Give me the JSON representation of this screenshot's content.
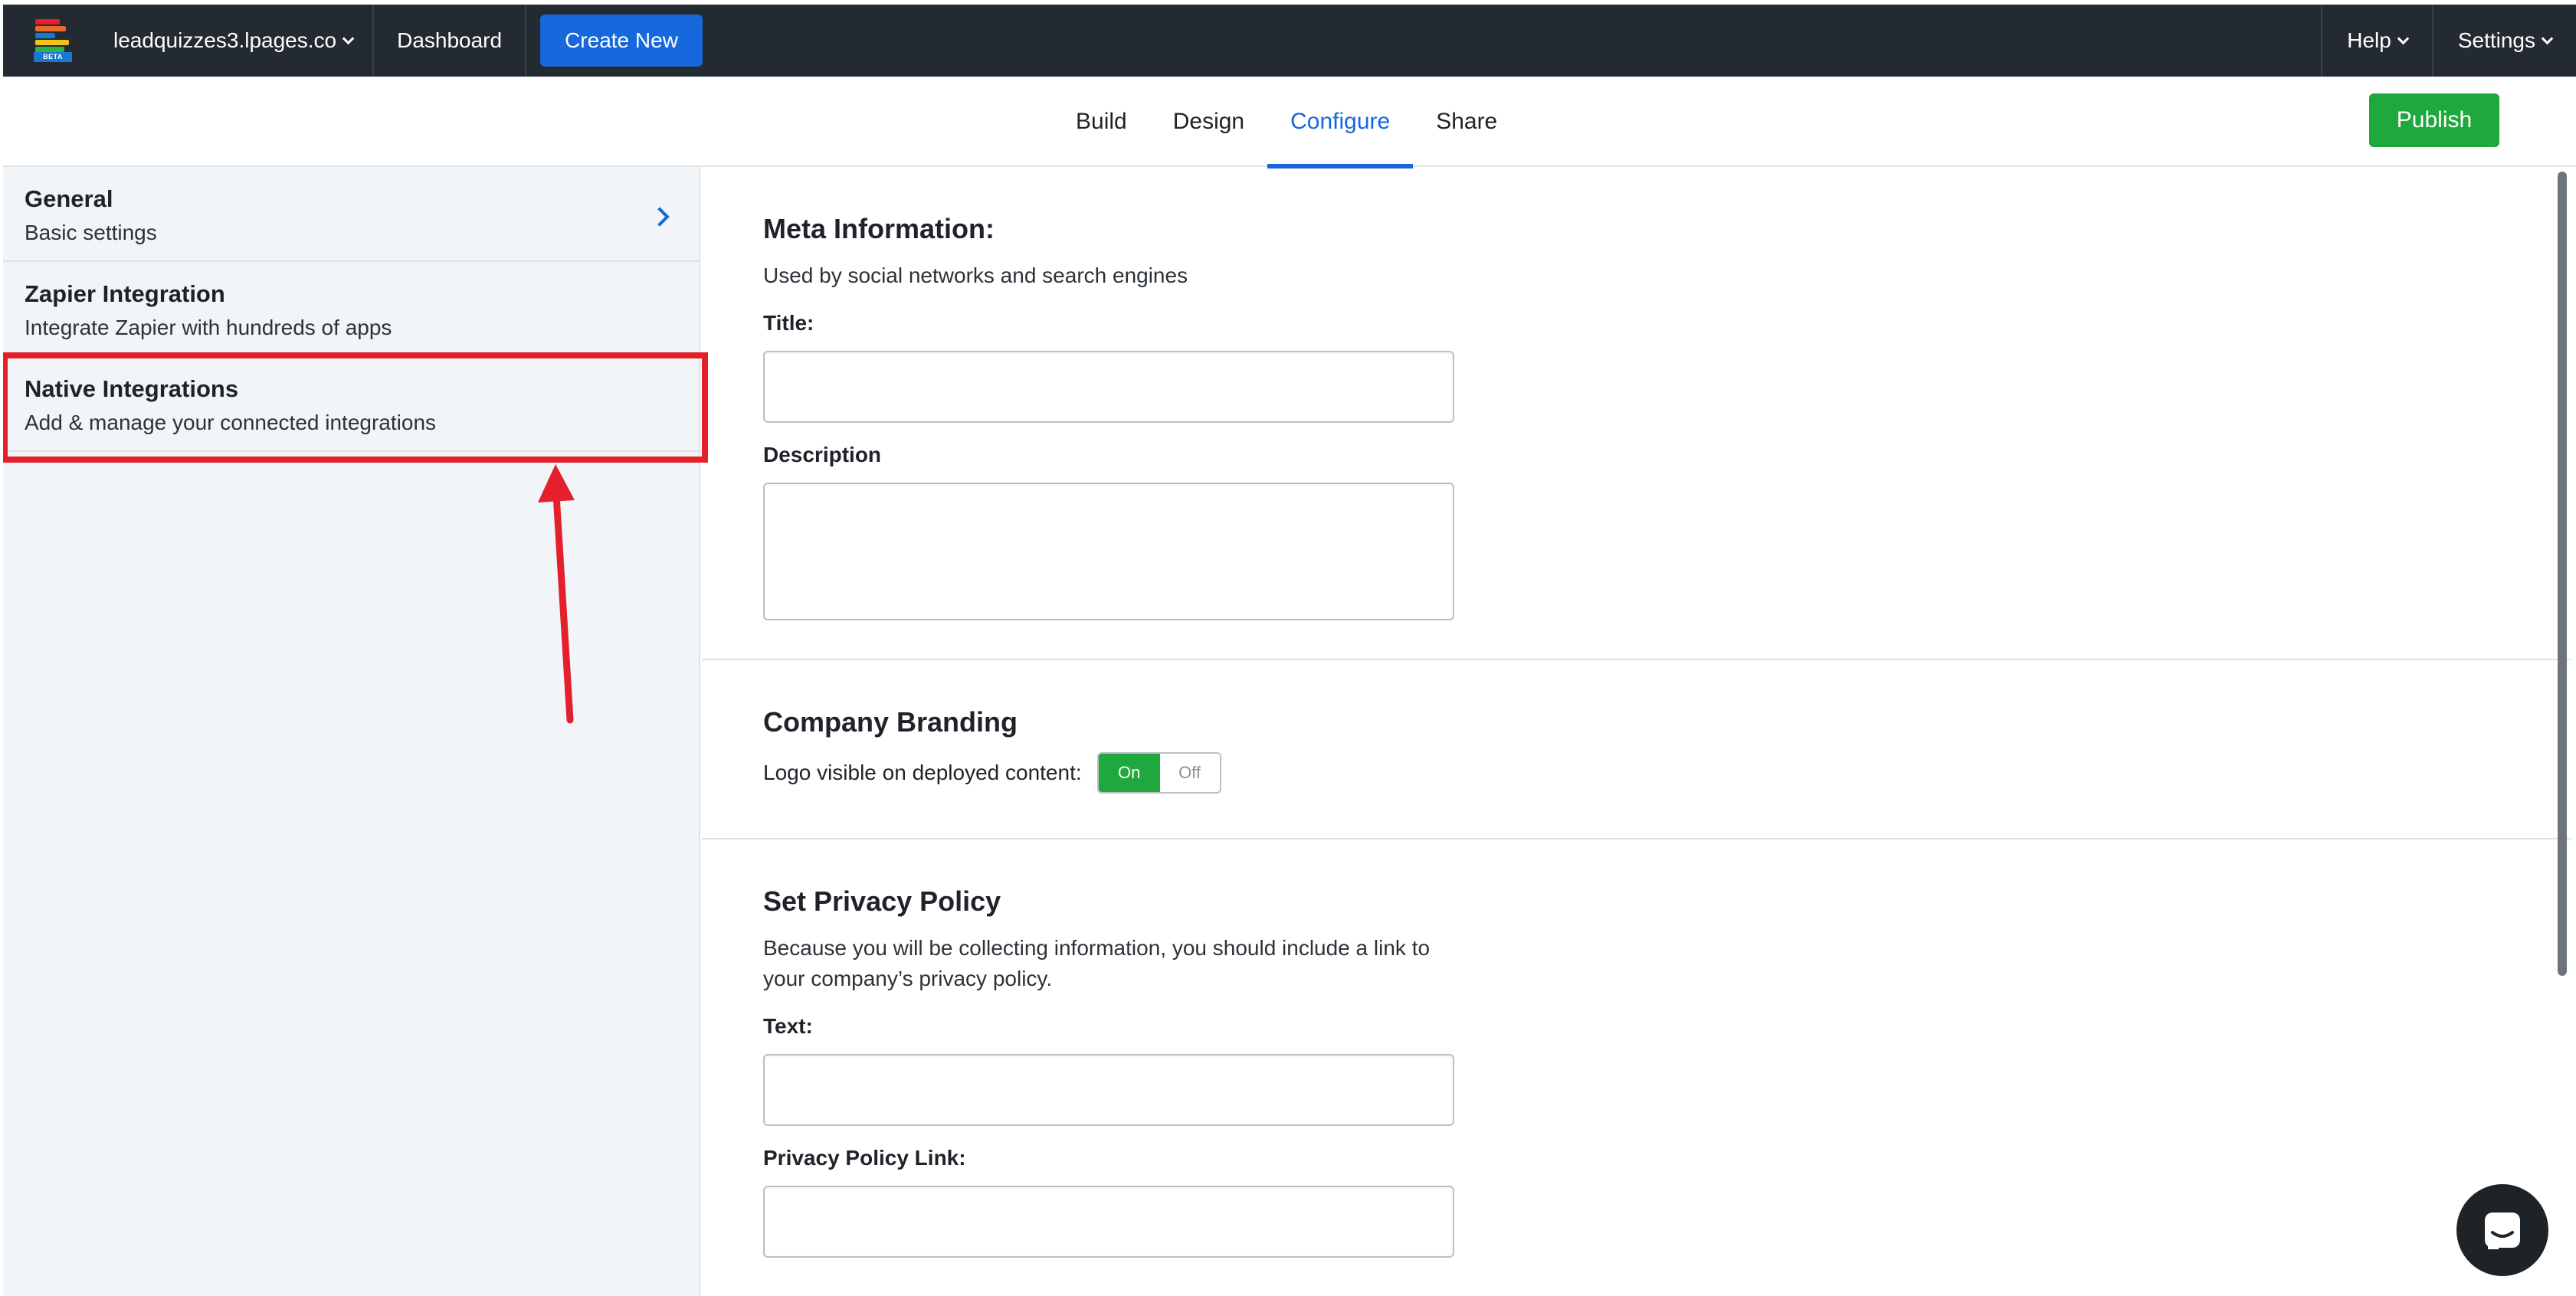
{
  "topbar": {
    "logo_badge": "BETA",
    "site_name": "leadquizzes3.lpages.co",
    "dashboard": "Dashboard",
    "create_new": "Create New",
    "help": "Help",
    "settings": "Settings"
  },
  "tabs": [
    {
      "label": "Build"
    },
    {
      "label": "Design"
    },
    {
      "label": "Configure",
      "active": true
    },
    {
      "label": "Share"
    }
  ],
  "publish": "Publish",
  "sidebar": {
    "items": [
      {
        "title": "General",
        "subtitle": "Basic settings"
      },
      {
        "title": "Zapier Integration",
        "subtitle": "Integrate Zapier with hundreds of apps"
      },
      {
        "title": "Native Integrations",
        "subtitle": "Add & manage your connected integrations"
      }
    ]
  },
  "meta": {
    "heading": "Meta Information:",
    "hint": "Used by social networks and search engines",
    "title_label": "Title:",
    "title_value": "",
    "description_label": "Description",
    "description_value": ""
  },
  "branding": {
    "heading": "Company Branding",
    "label": "Logo visible on deployed content:",
    "on": "On",
    "off": "Off",
    "selected": "On"
  },
  "privacy": {
    "heading": "Set Privacy Policy",
    "hint": "Because you will be collecting information, you should include a link to your company’s privacy policy.",
    "text_label": "Text:",
    "text_value": "",
    "link_label": "Privacy Policy Link:",
    "link_value": ""
  },
  "colors": {
    "topbar": "#242a31",
    "accent": "#1668dc",
    "publish": "#1fa83d",
    "highlight": "#e3202c"
  },
  "icons": [
    "chevron-down-icon",
    "chevron-right-icon",
    "chat-icon",
    "logo-icon"
  ]
}
